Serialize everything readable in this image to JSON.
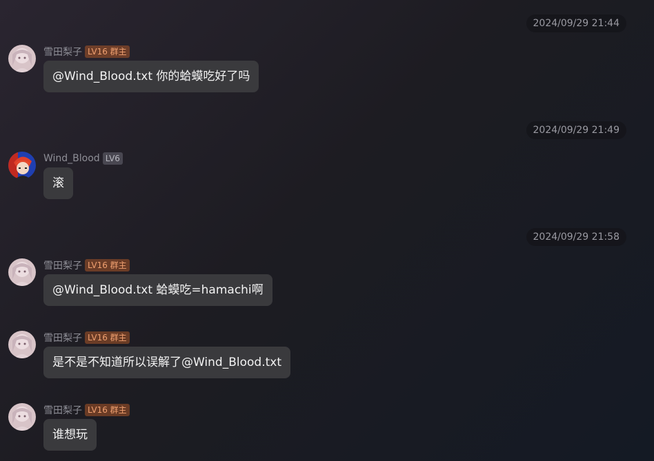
{
  "timestamps": [
    "2024/09/29 21:44",
    "2024/09/29 21:49",
    "2024/09/29 21:58"
  ],
  "messages": [
    {
      "sender": "雪田梨子",
      "badge": "LV16 群主",
      "text": "@Wind_Blood.txt 你的蛤蟆吃好了吗"
    },
    {
      "sender": "Wind_Blood",
      "badge": "LV6",
      "text": "滚"
    },
    {
      "sender": "雪田梨子",
      "badge": "LV16 群主",
      "text": "@Wind_Blood.txt 蛤蟆吃=hamachi啊"
    },
    {
      "sender": "雪田梨子",
      "badge": "LV16 群主",
      "text": "是不是不知道所以误解了@Wind_Blood.txt"
    },
    {
      "sender": "雪田梨子",
      "badge": "LV16 群主",
      "text": "谁想玩"
    }
  ],
  "avatars": {
    "yukita": "anime-girl-avatar",
    "wind_blood": "red-hair-character-avatar"
  },
  "colors": {
    "owner_badge": "#f0a070",
    "bubble_bg": "#3a3a3d",
    "timestamp_bg": "#14141a"
  }
}
